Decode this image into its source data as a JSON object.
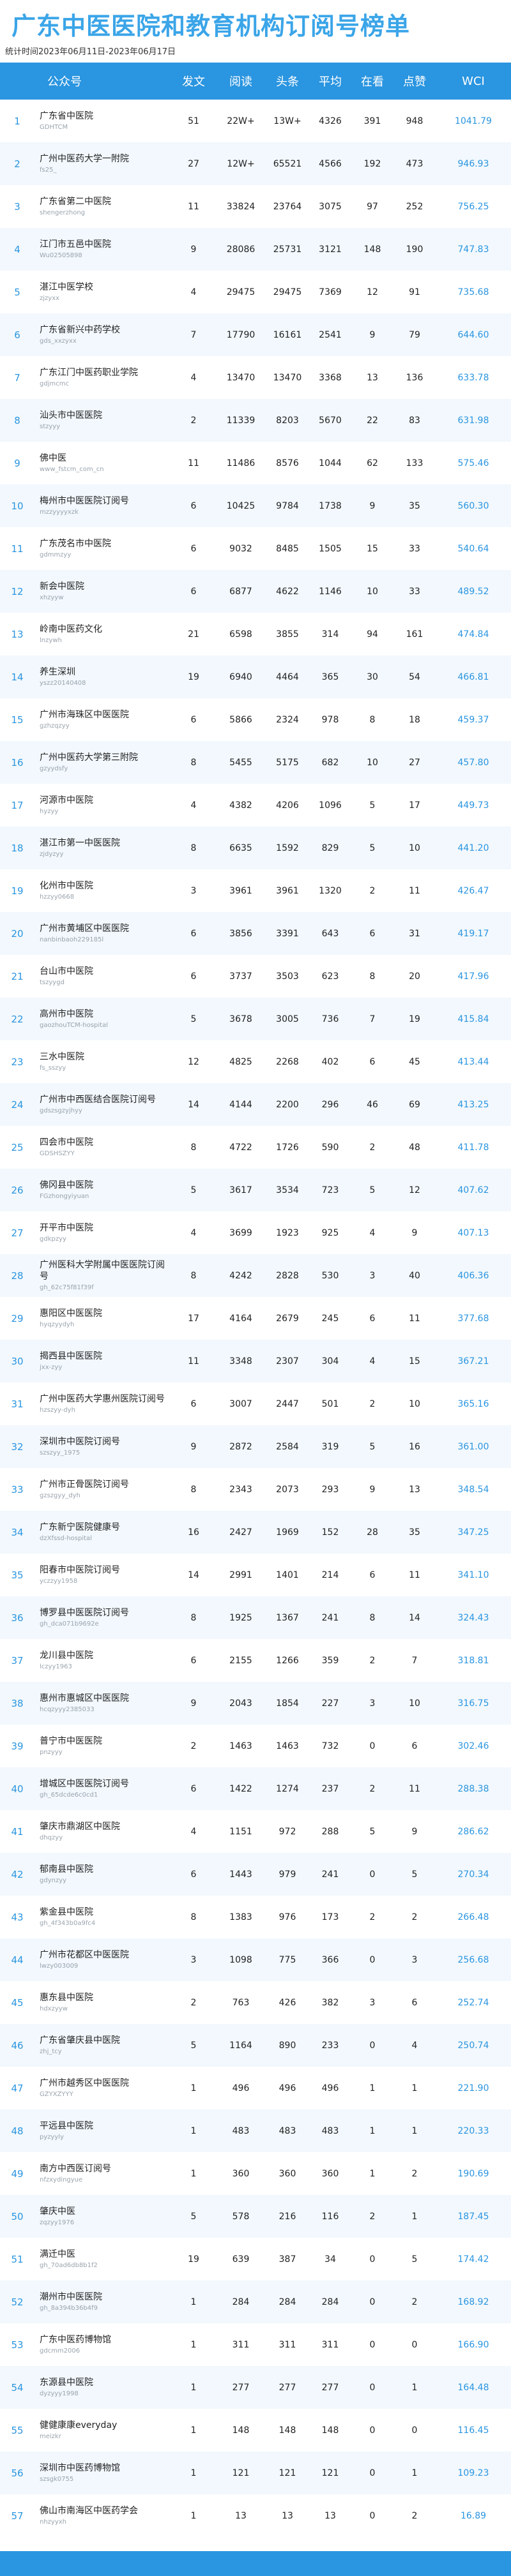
{
  "header": {
    "title": "广东中医医院和教育机构订阅号榜单",
    "subtitle": "统计时间2023年06月11日-2023年06月17日"
  },
  "columns": [
    "",
    "公众号",
    "发文",
    "阅读",
    "头条",
    "平均",
    "在看",
    "点赞",
    "WCI"
  ],
  "rows": [
    {
      "idx": "1",
      "name": "广东省中医院",
      "id": "GDHTCM",
      "posts": "51",
      "reads": "22W+",
      "top": "13W+",
      "avg": "4326",
      "look": "391",
      "like": "948",
      "wci": "1041.79"
    },
    {
      "idx": "2",
      "name": "广州中医药大学一附院",
      "id": "fs25_",
      "posts": "27",
      "reads": "12W+",
      "top": "65521",
      "avg": "4566",
      "look": "192",
      "like": "473",
      "wci": "946.93"
    },
    {
      "idx": "3",
      "name": "广东省第二中医院",
      "id": "shengerzhong",
      "posts": "11",
      "reads": "33824",
      "top": "23764",
      "avg": "3075",
      "look": "97",
      "like": "252",
      "wci": "756.25"
    },
    {
      "idx": "4",
      "name": "江门市五邑中医院",
      "id": "Wu02505898",
      "posts": "9",
      "reads": "28086",
      "top": "25731",
      "avg": "3121",
      "look": "148",
      "like": "190",
      "wci": "747.83"
    },
    {
      "idx": "5",
      "name": "湛江中医学校",
      "id": "zjzyxx",
      "posts": "4",
      "reads": "29475",
      "top": "29475",
      "avg": "7369",
      "look": "12",
      "like": "91",
      "wci": "735.68"
    },
    {
      "idx": "6",
      "name": "广东省新兴中药学校",
      "id": "gds_xxzyxx",
      "posts": "7",
      "reads": "17790",
      "top": "16161",
      "avg": "2541",
      "look": "9",
      "like": "79",
      "wci": "644.60"
    },
    {
      "idx": "7",
      "name": "广东江门中医药职业学院",
      "id": "gdjmcmc",
      "posts": "4",
      "reads": "13470",
      "top": "13470",
      "avg": "3368",
      "look": "13",
      "like": "136",
      "wci": "633.78"
    },
    {
      "idx": "8",
      "name": "汕头市中医医院",
      "id": "stzyyy",
      "posts": "2",
      "reads": "11339",
      "top": "8203",
      "avg": "5670",
      "look": "22",
      "like": "83",
      "wci": "631.98"
    },
    {
      "idx": "9",
      "name": "佛中医",
      "id": "www_fstcm_com_cn",
      "posts": "11",
      "reads": "11486",
      "top": "8576",
      "avg": "1044",
      "look": "62",
      "like": "133",
      "wci": "575.46"
    },
    {
      "idx": "10",
      "name": "梅州市中医医院订阅号",
      "id": "mzzyyyyxzk",
      "posts": "6",
      "reads": "10425",
      "top": "9784",
      "avg": "1738",
      "look": "9",
      "like": "35",
      "wci": "560.30"
    },
    {
      "idx": "11",
      "name": "广东茂名市中医院",
      "id": "gdmmzyy",
      "posts": "6",
      "reads": "9032",
      "top": "8485",
      "avg": "1505",
      "look": "15",
      "like": "33",
      "wci": "540.64"
    },
    {
      "idx": "12",
      "name": "新会中医院",
      "id": "xhzyyw",
      "posts": "6",
      "reads": "6877",
      "top": "4622",
      "avg": "1146",
      "look": "10",
      "like": "33",
      "wci": "489.52"
    },
    {
      "idx": "13",
      "name": "岭南中医药文化",
      "id": "lnzywh",
      "posts": "21",
      "reads": "6598",
      "top": "3855",
      "avg": "314",
      "look": "94",
      "like": "161",
      "wci": "474.84"
    },
    {
      "idx": "14",
      "name": "养生深圳",
      "id": "yszz20140408",
      "posts": "19",
      "reads": "6940",
      "top": "4464",
      "avg": "365",
      "look": "30",
      "like": "54",
      "wci": "466.81"
    },
    {
      "idx": "15",
      "name": "广州市海珠区中医医院",
      "id": "gzhzqzyy",
      "posts": "6",
      "reads": "5866",
      "top": "2324",
      "avg": "978",
      "look": "8",
      "like": "18",
      "wci": "459.37"
    },
    {
      "idx": "16",
      "name": "广州中医药大学第三附院",
      "id": "gzyydsfy",
      "posts": "8",
      "reads": "5455",
      "top": "5175",
      "avg": "682",
      "look": "10",
      "like": "27",
      "wci": "457.80"
    },
    {
      "idx": "17",
      "name": "河源市中医院",
      "id": "hyzyy",
      "posts": "4",
      "reads": "4382",
      "top": "4206",
      "avg": "1096",
      "look": "5",
      "like": "17",
      "wci": "449.73"
    },
    {
      "idx": "18",
      "name": "湛江市第一中医医院",
      "id": "zjdyzyy",
      "posts": "8",
      "reads": "6635",
      "top": "1592",
      "avg": "829",
      "look": "5",
      "like": "10",
      "wci": "441.20"
    },
    {
      "idx": "19",
      "name": "化州市中医院",
      "id": "hzzyy0668",
      "posts": "3",
      "reads": "3961",
      "top": "3961",
      "avg": "1320",
      "look": "2",
      "like": "11",
      "wci": "426.47"
    },
    {
      "idx": "20",
      "name": "广州市黄埔区中医医院",
      "id": "nanbinbaoh229185l",
      "posts": "6",
      "reads": "3856",
      "top": "3391",
      "avg": "643",
      "look": "6",
      "like": "31",
      "wci": "419.17"
    },
    {
      "idx": "21",
      "name": "台山市中医院",
      "id": "tszyygd",
      "posts": "6",
      "reads": "3737",
      "top": "3503",
      "avg": "623",
      "look": "8",
      "like": "20",
      "wci": "417.96"
    },
    {
      "idx": "22",
      "name": "高州市中医院",
      "id": "gaozhouTCM-hospital",
      "posts": "5",
      "reads": "3678",
      "top": "3005",
      "avg": "736",
      "look": "7",
      "like": "19",
      "wci": "415.84"
    },
    {
      "idx": "23",
      "name": "三水中医院",
      "id": "fs_sszyy",
      "posts": "12",
      "reads": "4825",
      "top": "2268",
      "avg": "402",
      "look": "6",
      "like": "45",
      "wci": "413.44"
    },
    {
      "idx": "24",
      "name": "广州市中西医结合医院订阅号",
      "id": "gdszsgzyjhyy",
      "posts": "14",
      "reads": "4144",
      "top": "2200",
      "avg": "296",
      "look": "46",
      "like": "69",
      "wci": "413.25"
    },
    {
      "idx": "25",
      "name": "四会市中医院",
      "id": "GDSHSZYY",
      "posts": "8",
      "reads": "4722",
      "top": "1726",
      "avg": "590",
      "look": "2",
      "like": "48",
      "wci": "411.78"
    },
    {
      "idx": "26",
      "name": "佛冈县中医院",
      "id": "FGzhongyiyuan",
      "posts": "5",
      "reads": "3617",
      "top": "3534",
      "avg": "723",
      "look": "5",
      "like": "12",
      "wci": "407.62"
    },
    {
      "idx": "27",
      "name": "开平市中医院",
      "id": "gdkpzyy",
      "posts": "4",
      "reads": "3699",
      "top": "1923",
      "avg": "925",
      "look": "4",
      "like": "9",
      "wci": "407.13"
    },
    {
      "idx": "28",
      "name": "广州医科大学附属中医医院订阅号",
      "id": "gh_62c75f81f39f",
      "posts": "8",
      "reads": "4242",
      "top": "2828",
      "avg": "530",
      "look": "3",
      "like": "40",
      "wci": "406.36"
    },
    {
      "idx": "29",
      "name": "惠阳区中医医院",
      "id": "hyqzyydyh",
      "posts": "17",
      "reads": "4164",
      "top": "2679",
      "avg": "245",
      "look": "6",
      "like": "11",
      "wci": "377.68"
    },
    {
      "idx": "30",
      "name": "揭西县中医医院",
      "id": "jxx-zyy",
      "posts": "11",
      "reads": "3348",
      "top": "2307",
      "avg": "304",
      "look": "4",
      "like": "15",
      "wci": "367.21"
    },
    {
      "idx": "31",
      "name": "广州中医药大学惠州医院订阅号",
      "id": "hzszyy-dyh",
      "posts": "6",
      "reads": "3007",
      "top": "2447",
      "avg": "501",
      "look": "2",
      "like": "10",
      "wci": "365.16"
    },
    {
      "idx": "32",
      "name": "深圳市中医院订阅号",
      "id": "szszyy_1975",
      "posts": "9",
      "reads": "2872",
      "top": "2584",
      "avg": "319",
      "look": "5",
      "like": "16",
      "wci": "361.00"
    },
    {
      "idx": "33",
      "name": "广州市正骨医院订阅号",
      "id": "gzszgyy_dyh",
      "posts": "8",
      "reads": "2343",
      "top": "2073",
      "avg": "293",
      "look": "9",
      "like": "13",
      "wci": "348.54"
    },
    {
      "idx": "34",
      "name": "广东新宁医院健康号",
      "id": "dzXfssd-hospital",
      "posts": "16",
      "reads": "2427",
      "top": "1969",
      "avg": "152",
      "look": "28",
      "like": "35",
      "wci": "347.25"
    },
    {
      "idx": "35",
      "name": "阳春市中医院订阅号",
      "id": "yczzyy1958",
      "posts": "14",
      "reads": "2991",
      "top": "1401",
      "avg": "214",
      "look": "6",
      "like": "11",
      "wci": "341.10"
    },
    {
      "idx": "36",
      "name": "博罗县中医医院订阅号",
      "id": "gh_dca071b9692e",
      "posts": "8",
      "reads": "1925",
      "top": "1367",
      "avg": "241",
      "look": "8",
      "like": "14",
      "wci": "324.43"
    },
    {
      "idx": "37",
      "name": "龙川县中医院",
      "id": "lczyy1963",
      "posts": "6",
      "reads": "2155",
      "top": "1266",
      "avg": "359",
      "look": "2",
      "like": "7",
      "wci": "318.81"
    },
    {
      "idx": "38",
      "name": "惠州市惠城区中医医院",
      "id": "hcqzyyy2385033",
      "posts": "9",
      "reads": "2043",
      "top": "1854",
      "avg": "227",
      "look": "3",
      "like": "10",
      "wci": "316.75"
    },
    {
      "idx": "39",
      "name": "普宁市中医医院",
      "id": "pnzyyy",
      "posts": "2",
      "reads": "1463",
      "top": "1463",
      "avg": "732",
      "look": "0",
      "like": "6",
      "wci": "302.46"
    },
    {
      "idx": "40",
      "name": "增城区中医医院订阅号",
      "id": "gh_65dcde6c0cd1",
      "posts": "6",
      "reads": "1422",
      "top": "1274",
      "avg": "237",
      "look": "2",
      "like": "11",
      "wci": "288.38"
    },
    {
      "idx": "41",
      "name": "肇庆市鼎湖区中医院",
      "id": "dhqzyy",
      "posts": "4",
      "reads": "1151",
      "top": "972",
      "avg": "288",
      "look": "5",
      "like": "9",
      "wci": "286.62"
    },
    {
      "idx": "42",
      "name": "郁南县中医院",
      "id": "gdynzyy",
      "posts": "6",
      "reads": "1443",
      "top": "979",
      "avg": "241",
      "look": "0",
      "like": "5",
      "wci": "270.34"
    },
    {
      "idx": "43",
      "name": "紫金县中医院",
      "id": "gh_4f343b0a9fc4",
      "posts": "8",
      "reads": "1383",
      "top": "976",
      "avg": "173",
      "look": "2",
      "like": "2",
      "wci": "266.48"
    },
    {
      "idx": "44",
      "name": "广州市花都区中医医院",
      "id": "lwzy003009",
      "posts": "3",
      "reads": "1098",
      "top": "775",
      "avg": "366",
      "look": "0",
      "like": "3",
      "wci": "256.68"
    },
    {
      "idx": "45",
      "name": "惠东县中医院",
      "id": "hdxzyyw",
      "posts": "2",
      "reads": "763",
      "top": "426",
      "avg": "382",
      "look": "3",
      "like": "6",
      "wci": "252.74"
    },
    {
      "idx": "46",
      "name": "广东省肇庆县中医院",
      "id": "zhj_tcy",
      "posts": "5",
      "reads": "1164",
      "top": "890",
      "avg": "233",
      "look": "0",
      "like": "4",
      "wci": "250.74"
    },
    {
      "idx": "47",
      "name": "广州市越秀区中医医院",
      "id": "GZYXZYYY",
      "posts": "1",
      "reads": "496",
      "top": "496",
      "avg": "496",
      "look": "1",
      "like": "1",
      "wci": "221.90"
    },
    {
      "idx": "48",
      "name": "平远县中医院",
      "id": "pyzyyly",
      "posts": "1",
      "reads": "483",
      "top": "483",
      "avg": "483",
      "look": "1",
      "like": "1",
      "wci": "220.33"
    },
    {
      "idx": "49",
      "name": "南方中西医订阅号",
      "id": "nfzxydingyue",
      "posts": "1",
      "reads": "360",
      "top": "360",
      "avg": "360",
      "look": "1",
      "like": "2",
      "wci": "190.69"
    },
    {
      "idx": "50",
      "name": "肇庆中医",
      "id": "zqzyy1976",
      "posts": "5",
      "reads": "578",
      "top": "216",
      "avg": "116",
      "look": "2",
      "like": "1",
      "wci": "187.45"
    },
    {
      "idx": "51",
      "name": "满迁中医",
      "id": "gh_70ad6db8b1f2",
      "posts": "19",
      "reads": "639",
      "top": "387",
      "avg": "34",
      "look": "0",
      "like": "5",
      "wci": "174.42"
    },
    {
      "idx": "52",
      "name": "潮州市中医医院",
      "id": "gh_8a394b36b4f9",
      "posts": "1",
      "reads": "284",
      "top": "284",
      "avg": "284",
      "look": "0",
      "like": "2",
      "wci": "168.92"
    },
    {
      "idx": "53",
      "name": "广东中医药博物馆",
      "id": "gdcmm2006",
      "posts": "1",
      "reads": "311",
      "top": "311",
      "avg": "311",
      "look": "0",
      "like": "0",
      "wci": "166.90"
    },
    {
      "idx": "54",
      "name": "东源县中医院",
      "id": "dyzyyy1998",
      "posts": "1",
      "reads": "277",
      "top": "277",
      "avg": "277",
      "look": "0",
      "like": "1",
      "wci": "164.48"
    },
    {
      "idx": "55",
      "name": "健健康康everyday",
      "id": "meizkr",
      "posts": "1",
      "reads": "148",
      "top": "148",
      "avg": "148",
      "look": "0",
      "like": "0",
      "wci": "116.45"
    },
    {
      "idx": "56",
      "name": "深圳市中医药博物馆",
      "id": "szsgk0755",
      "posts": "1",
      "reads": "121",
      "top": "121",
      "avg": "121",
      "look": "0",
      "like": "1",
      "wci": "109.23"
    },
    {
      "idx": "57",
      "name": "佛山市南海区中医药学会",
      "id": "nhzyyxh",
      "posts": "1",
      "reads": "13",
      "top": "13",
      "avg": "13",
      "look": "0",
      "like": "2",
      "wci": "16.89"
    }
  ]
}
